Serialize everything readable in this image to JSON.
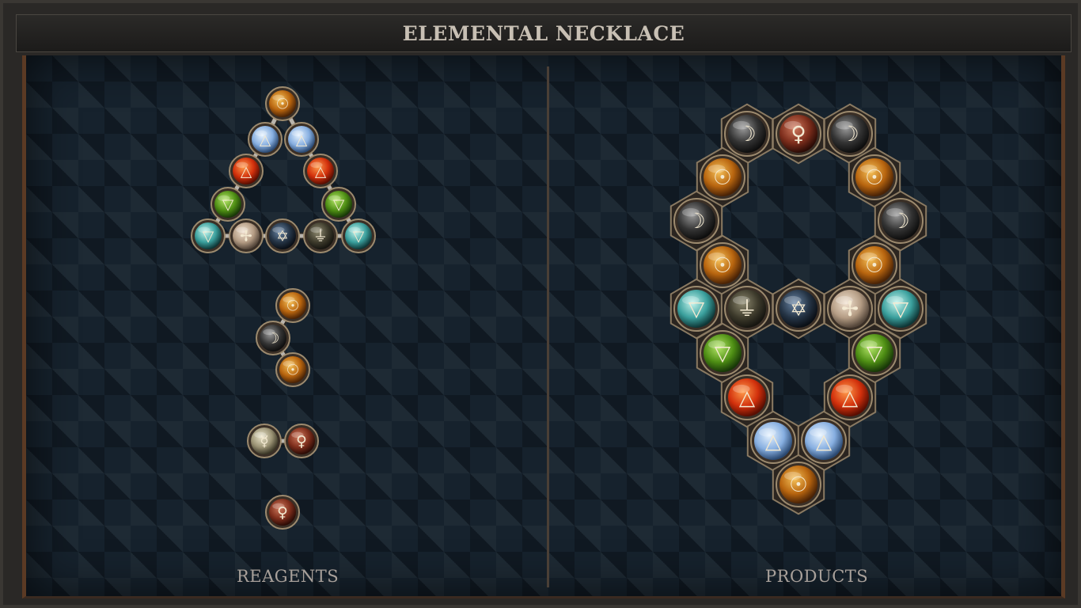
{
  "title": "ELEMENTAL NECKLACE",
  "reagents_label": "REAGENTS",
  "products_label": "PRODUCTS",
  "colors": {
    "gold": "#c77a1a",
    "air": "#8fb8e8",
    "fire": "#d63a14",
    "earth": "#5c9a1e",
    "water": "#3aa3a0",
    "salt": "#b9a58e",
    "quint": "#2a3a4a",
    "lead": "#4a4636",
    "quicksilver": "#3a3a3a",
    "copper": "#8a3a28",
    "tin": "#a59a7a"
  },
  "gems": {
    "sun": "☉",
    "moon": "☽",
    "venus": "♀",
    "mercury": "☿",
    "fire": "🜂",
    "air": "🜁",
    "water": "🜄",
    "earth": "🜃"
  }
}
